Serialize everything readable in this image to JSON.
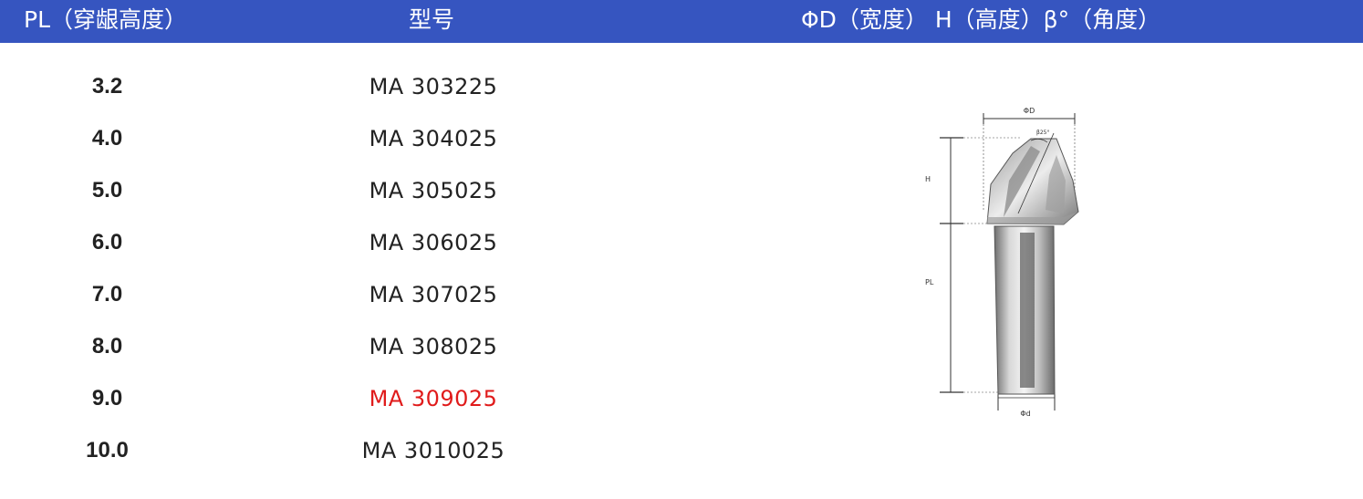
{
  "header": {
    "pl_label": "PL（穿龈高度）",
    "model_label": "型号",
    "dims_label": "ΦD（宽度） H（高度）β°（角度）"
  },
  "rows": [
    {
      "pl": "3.2",
      "model": "MA 303225"
    },
    {
      "pl": "4.0",
      "model": "MA 304025"
    },
    {
      "pl": "5.0",
      "model": "MA 305025"
    },
    {
      "pl": "6.0",
      "model": "MA 306025"
    },
    {
      "pl": "7.0",
      "model": "MA 307025"
    },
    {
      "pl": "8.0",
      "model": "MA 308025"
    },
    {
      "pl": "9.0",
      "model": "MA 309025"
    },
    {
      "pl": "10.0",
      "model": "MA 3010025"
    }
  ],
  "drawing": {
    "label_D": "ΦD",
    "label_H": "H",
    "label_PL": "PL",
    "label_d": "Φd",
    "label_angle": "β25°"
  },
  "colors": {
    "header_bg": "#3655c0",
    "highlight": "#e01b1b"
  }
}
